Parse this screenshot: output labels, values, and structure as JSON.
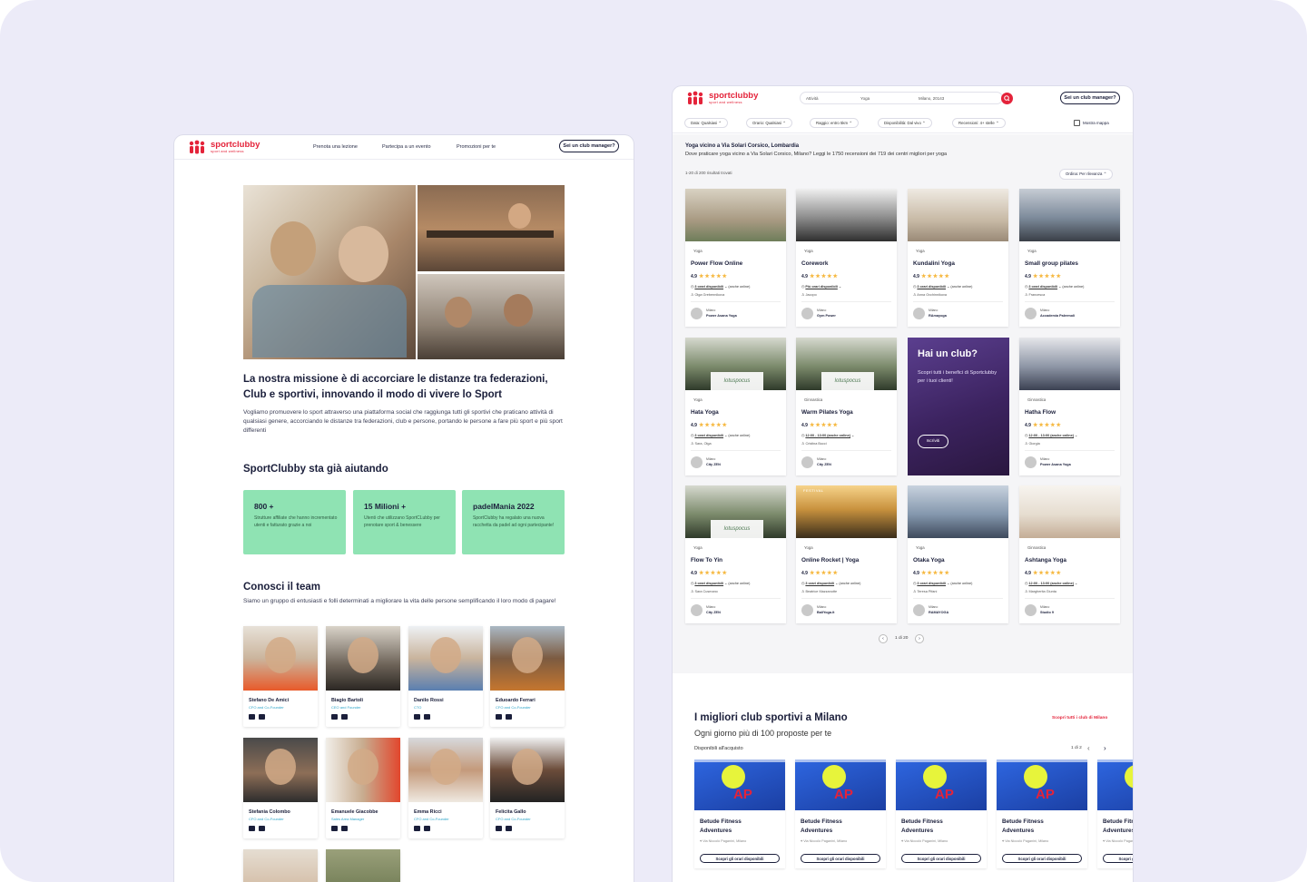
{
  "brand": {
    "name": "sportclubby",
    "tagline": "sport and wellness",
    "color": "#e4233a"
  },
  "left_page": {
    "nav": {
      "items": [
        "Prenota una lezione",
        "Partecipa a un evento",
        "Promozioni per te"
      ],
      "cta": "Sei un club manager?"
    },
    "mission": {
      "title": "La nostra missione è di accorciare le distanze tra federazioni, Club e sportivi, innovando il modo di vivere lo Sport",
      "body": "Vogliamo promuovere lo sport attraverso una piattaforma social che raggiunga tutti gli sportivi che praticano attività di qualsiasi genere, accorciando le distanze tra federazioni, club e persone, portando le persone a fare più sport e più sport differenti"
    },
    "helping": {
      "title": "SportClubby sta già aiutando",
      "stats": [
        {
          "title": "800 +",
          "desc": "Strutture affiliate che hanno incrementato utenti e fatturato grazie a noi"
        },
        {
          "title": "15 Milioni  +",
          "desc": "Utenti che utilizzano SportCLubby per prenotare sport & benessere"
        },
        {
          "title": "padelMania 2022",
          "desc": "SportClubby ha regalato una nuova racchetta da padel ad ogni partecipante!"
        }
      ]
    },
    "team": {
      "title": "Conosci il team",
      "subtitle": "Siamo un gruppo di entusiasti e folli determinati a migliorare la vita delle persone semplificando il loro modo di pagare!",
      "members": [
        {
          "name": "Stefano De Amici",
          "role": "CFO and Co-Founder"
        },
        {
          "name": "Biagio Bartoli",
          "role": "CEO and Founder"
        },
        {
          "name": "Danilo Rossi",
          "role": "CTO"
        },
        {
          "name": "Eduoardo Ferrari",
          "role": "CFO and Co-Founder"
        },
        {
          "name": "Stefania Colombo",
          "role": "CFO and Co-Founder"
        },
        {
          "name": "Emanuele Giacobbe",
          "role": "Sales Area Manager"
        },
        {
          "name": "Emma Ricci",
          "role": "CFO and Co-Founder"
        },
        {
          "name": "Felicita Gallo",
          "role": "CFO and Co-Founder"
        }
      ]
    }
  },
  "right_page": {
    "header": {
      "search": {
        "activity_label": "Attività",
        "activity_value": "Yoga",
        "location_value": "Milano, 20143"
      },
      "cta": "Sei un club manager?"
    },
    "filters": [
      "Data: Qualsiasi",
      "Orario: Qualsiasi",
      "Raggio: entro 5km",
      "Disponibilità: Dal vivo",
      "Recensioni: 4+ stelle"
    ],
    "map_toggle": "Mostra mappa",
    "results": {
      "title": "Yoga vicino a Via Solari Corsico, Lombardia",
      "desc": "Dove praticare yoga vicino a Via Solari Corsico, Milano? Leggi le 1750 recensioni dei 719 dei centri migliori per yoga",
      "count": "1-20 di 200 risultati trovati",
      "sort": "Ordina: Per rilevanza"
    },
    "cards": [
      {
        "cat": "Yoga",
        "title": "Power Flow Online",
        "rating": "4.9",
        "slots": "3 orari disponibili",
        "mode": "(anche online)",
        "teacher": "Olga Grebennikova",
        "city": "Milano",
        "studio": "Power Asana Yoga"
      },
      {
        "cat": "Yoga",
        "title": "Corework",
        "rating": "4.9",
        "slots": "Più orari disponibili",
        "mode": "",
        "teacher": "Jacopo",
        "city": "Milano",
        "studio": "Gym Power"
      },
      {
        "cat": "Yoga",
        "title": "Kundalini Yoga",
        "rating": "4.9",
        "slots": "3 orari disponibili",
        "mode": "(anche online)",
        "teacher": "Anna Ovchinnikova",
        "city": "Milano",
        "studio": "RAmayoga"
      },
      {
        "cat": "Yoga",
        "title": "Small group pilates",
        "rating": "4.9",
        "slots": "3 orari disponibili",
        "mode": "(anche online)",
        "teacher": "Francesca",
        "city": "Milano",
        "studio": "Accademia Palermoli"
      },
      {
        "cat": "Yoga",
        "title": "Hata Yoga",
        "rating": "4.9",
        "slots": "3 orari disponibili",
        "mode": "(anche online)",
        "teacher": "Sara, Olga",
        "city": "Milano",
        "studio": "City ZEN"
      },
      {
        "cat": "Ginnastica",
        "title": "Warm Pilates Yoga",
        "rating": "4.9",
        "slots": "12:00 - 13:00 (anche online)",
        "mode": "",
        "teacher": "Cristina Bucci",
        "city": "Milano",
        "studio": "City ZEN"
      },
      {
        "cat": "Ginnastica",
        "title": "Hatha Flow",
        "rating": "4.9",
        "slots": "12:00 - 13:00 (anche online)",
        "mode": "",
        "teacher": "Giorgia",
        "city": "Milano",
        "studio": "Power Asana Yoga"
      },
      {
        "cat": "Yoga",
        "title": "Flow To Yin",
        "rating": "4.9",
        "slots": "3 orari disponibili",
        "mode": "(anche online)",
        "teacher": "Sara Cusmano",
        "city": "Milano",
        "studio": "City ZEN"
      },
      {
        "cat": "Yoga",
        "title": "Online Rocket | Yoga",
        "rating": "4.9",
        "slots": "3 orari disponibili",
        "mode": "(anche online)",
        "teacher": "Beatrice Mazzanotte",
        "city": "Milano",
        "studio": "BaliYoga.it"
      },
      {
        "cat": "Yoga",
        "title": "Otaka Yoga",
        "rating": "4.9",
        "slots": "3 orari disponibili",
        "mode": "(anche online)",
        "teacher": "Teresa Pifani",
        "city": "Milano",
        "studio": "RAMAYOGA"
      },
      {
        "cat": "Ginnastica",
        "title": "Ashtanga Yoga",
        "rating": "4.9",
        "slots": "12:00 - 13:00 (anche online)",
        "mode": "",
        "teacher": "Margherita Giunta",
        "city": "Milano",
        "studio": "Studio 9"
      }
    ],
    "promo": {
      "title": "Hai un club?",
      "desc": "Scopri tutti i benefici di Sportclubby per i tuoi clienti!",
      "button": "Iscriviti"
    },
    "logo_overlay": "lotuspocus",
    "festival_text": "FESTIVAL",
    "pagination": "1 di 20",
    "best": {
      "title": "I migliori club sportivi a Milano",
      "subtitle": "Ogni giorno più di 100 proposte per te",
      "link": "Scopri tutti i club di Milano",
      "available": "Disponibili all'acquisto",
      "page": "1 di 2",
      "item": {
        "title": "Betude Fitness Adventures",
        "address": "Via Niccolò Paganini, Milano",
        "button": "Scopri gli orari disponibili",
        "img_text": "AP"
      }
    }
  }
}
